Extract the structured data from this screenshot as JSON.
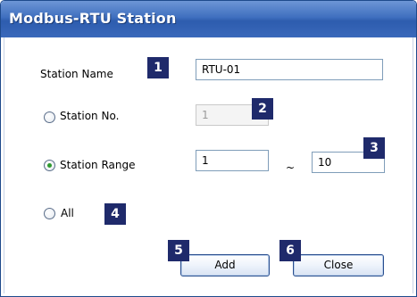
{
  "window": {
    "title": "Modbus-RTU Station"
  },
  "station_name": {
    "label": "Station Name",
    "value": "RTU-01"
  },
  "station_no": {
    "label": "Station No.",
    "value": "1",
    "selected": false
  },
  "station_range": {
    "label": "Station Range",
    "from": "1",
    "separator": "~",
    "to": "10",
    "selected": true
  },
  "all": {
    "label": "All",
    "selected": false
  },
  "buttons": {
    "add": "Add",
    "close": "Close"
  },
  "badges": [
    "1",
    "2",
    "3",
    "4",
    "5",
    "6"
  ],
  "colors": {
    "title_bar": "#3f6fbf",
    "badge": "#1f2a6b",
    "radio_dot": "#2f9a2f"
  }
}
